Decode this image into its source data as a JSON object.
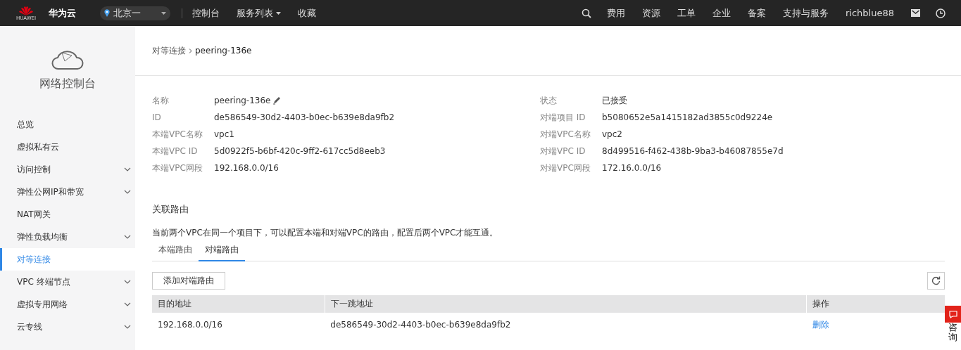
{
  "topbar": {
    "logo_text": "HUAWEI",
    "brand": "华为云",
    "region": "北京一",
    "nav": [
      {
        "label": "控制台",
        "has_menu": false
      },
      {
        "label": "服务列表",
        "has_menu": true
      },
      {
        "label": "收藏",
        "has_menu": false
      }
    ],
    "right_nav": [
      "费用",
      "资源",
      "工单",
      "企业",
      "备案",
      "支持与服务"
    ],
    "user": "richblue88"
  },
  "sidebar": {
    "title": "网络控制台",
    "items": [
      {
        "label": "总览",
        "expandable": false,
        "selected": false
      },
      {
        "label": "虚拟私有云",
        "expandable": false,
        "selected": false
      },
      {
        "label": "访问控制",
        "expandable": true,
        "selected": false
      },
      {
        "label": "弹性公网IP和带宽",
        "expandable": true,
        "selected": false
      },
      {
        "label": "NAT网关",
        "expandable": false,
        "selected": false
      },
      {
        "label": "弹性负载均衡",
        "expandable": true,
        "selected": false
      },
      {
        "label": "对等连接",
        "expandable": false,
        "selected": true
      },
      {
        "label": "VPC 终端节点",
        "expandable": true,
        "selected": false
      },
      {
        "label": "虚拟专用网络",
        "expandable": true,
        "selected": false
      },
      {
        "label": "云专线",
        "expandable": true,
        "selected": false
      }
    ]
  },
  "breadcrumb": {
    "parent": "对等连接",
    "current": "peering-136e"
  },
  "details_left": [
    {
      "label": "名称",
      "value": "peering-136e",
      "editable": true
    },
    {
      "label": "ID",
      "value": "de586549-30d2-4403-b0ec-b639e8da9fb2",
      "editable": false
    },
    {
      "label": "本端VPC名称",
      "value": "vpc1",
      "editable": false
    },
    {
      "label": "本端VPC ID",
      "value": "5d0922f5-b6bf-420c-9ff2-617cc5d8eeb3",
      "editable": false
    },
    {
      "label": "本端VPC网段",
      "value": "192.168.0.0/16",
      "editable": false
    }
  ],
  "details_right": [
    {
      "label": "状态",
      "value": "已接受",
      "editable": false
    },
    {
      "label": "对端项目 ID",
      "value": "b5080652e5a1415182ad3855c0d9224e",
      "editable": false
    },
    {
      "label": "对端VPC名称",
      "value": "vpc2",
      "editable": false
    },
    {
      "label": "对端VPC ID",
      "value": "8d499516-f462-438b-9ba3-b46087855e7d",
      "editable": false
    },
    {
      "label": "对端VPC网段",
      "value": "172.16.0.0/16",
      "editable": false
    }
  ],
  "section_title": "关联路由",
  "description": "当前两个VPC在同一个项目下，可以配置本端和对端VPC的路由，配置后两个VPC才能互通。",
  "tabs": [
    {
      "label": "本端路由",
      "selected": false
    },
    {
      "label": "对端路由",
      "selected": true
    }
  ],
  "add_button": "添加对端路由",
  "table": {
    "columns": [
      "目的地址",
      "下一跳地址",
      "操作"
    ],
    "rows": [
      {
        "cells": [
          "192.168.0.0/16",
          "de586549-30d2-4403-b0ec-b639e8da9fb2"
        ],
        "action": "删除"
      }
    ]
  },
  "consult_tab": {
    "label": "咨询"
  }
}
